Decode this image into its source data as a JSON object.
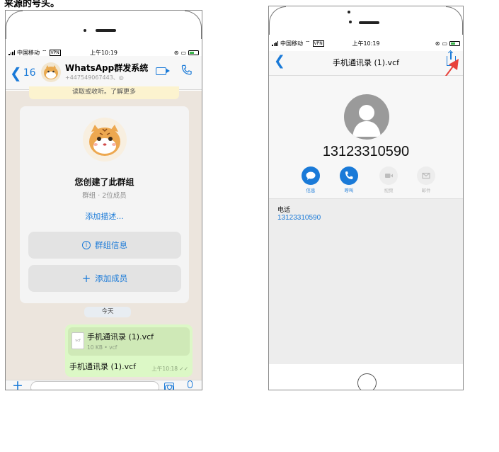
{
  "top_caption": "来源的号头。",
  "left_phone": {
    "statusbar": {
      "carrier": "中国移动",
      "network": "VPN",
      "time": "上午10:19"
    },
    "header": {
      "back_chevron": "❮",
      "back_count": "16",
      "title": "WhatsApp群发系统",
      "subtitle": "+447549067443、◎"
    },
    "encryption_notice": "读取或收听。了解更多",
    "group_card": {
      "created": "您创建了此群组",
      "members": "群组 · 2位成员",
      "add_description": "添加描述...",
      "group_info_icon": "i",
      "group_info_label": "群组信息",
      "add_member_icon": "+",
      "add_member_label": "添加成员"
    },
    "date_pill": "今天",
    "message": {
      "file_icon_text": "vcf",
      "file_name": "手机通讯录 (1).vcf",
      "file_meta": "10 KB • vcf",
      "caption": "手机通讯录 (1).vcf",
      "time": "上午10:18 ✓✓"
    },
    "input": {
      "plus": "+"
    }
  },
  "right_phone": {
    "statusbar": {
      "carrier": "中国移动",
      "network": "VPN",
      "time": "上午10:19"
    },
    "nav": {
      "back_chevron": "❮",
      "title": "手机通讯录 (1).vcf"
    },
    "contact": {
      "number_big": "13123310590",
      "actions": [
        {
          "label": "信息"
        },
        {
          "label": "呼叫"
        },
        {
          "label": "视频"
        },
        {
          "label": "邮件"
        }
      ],
      "phone_label": "电话",
      "phone_value": "13123310590"
    },
    "arrow_color": "#e8413a",
    "accent_color": "#1a7ad8"
  }
}
